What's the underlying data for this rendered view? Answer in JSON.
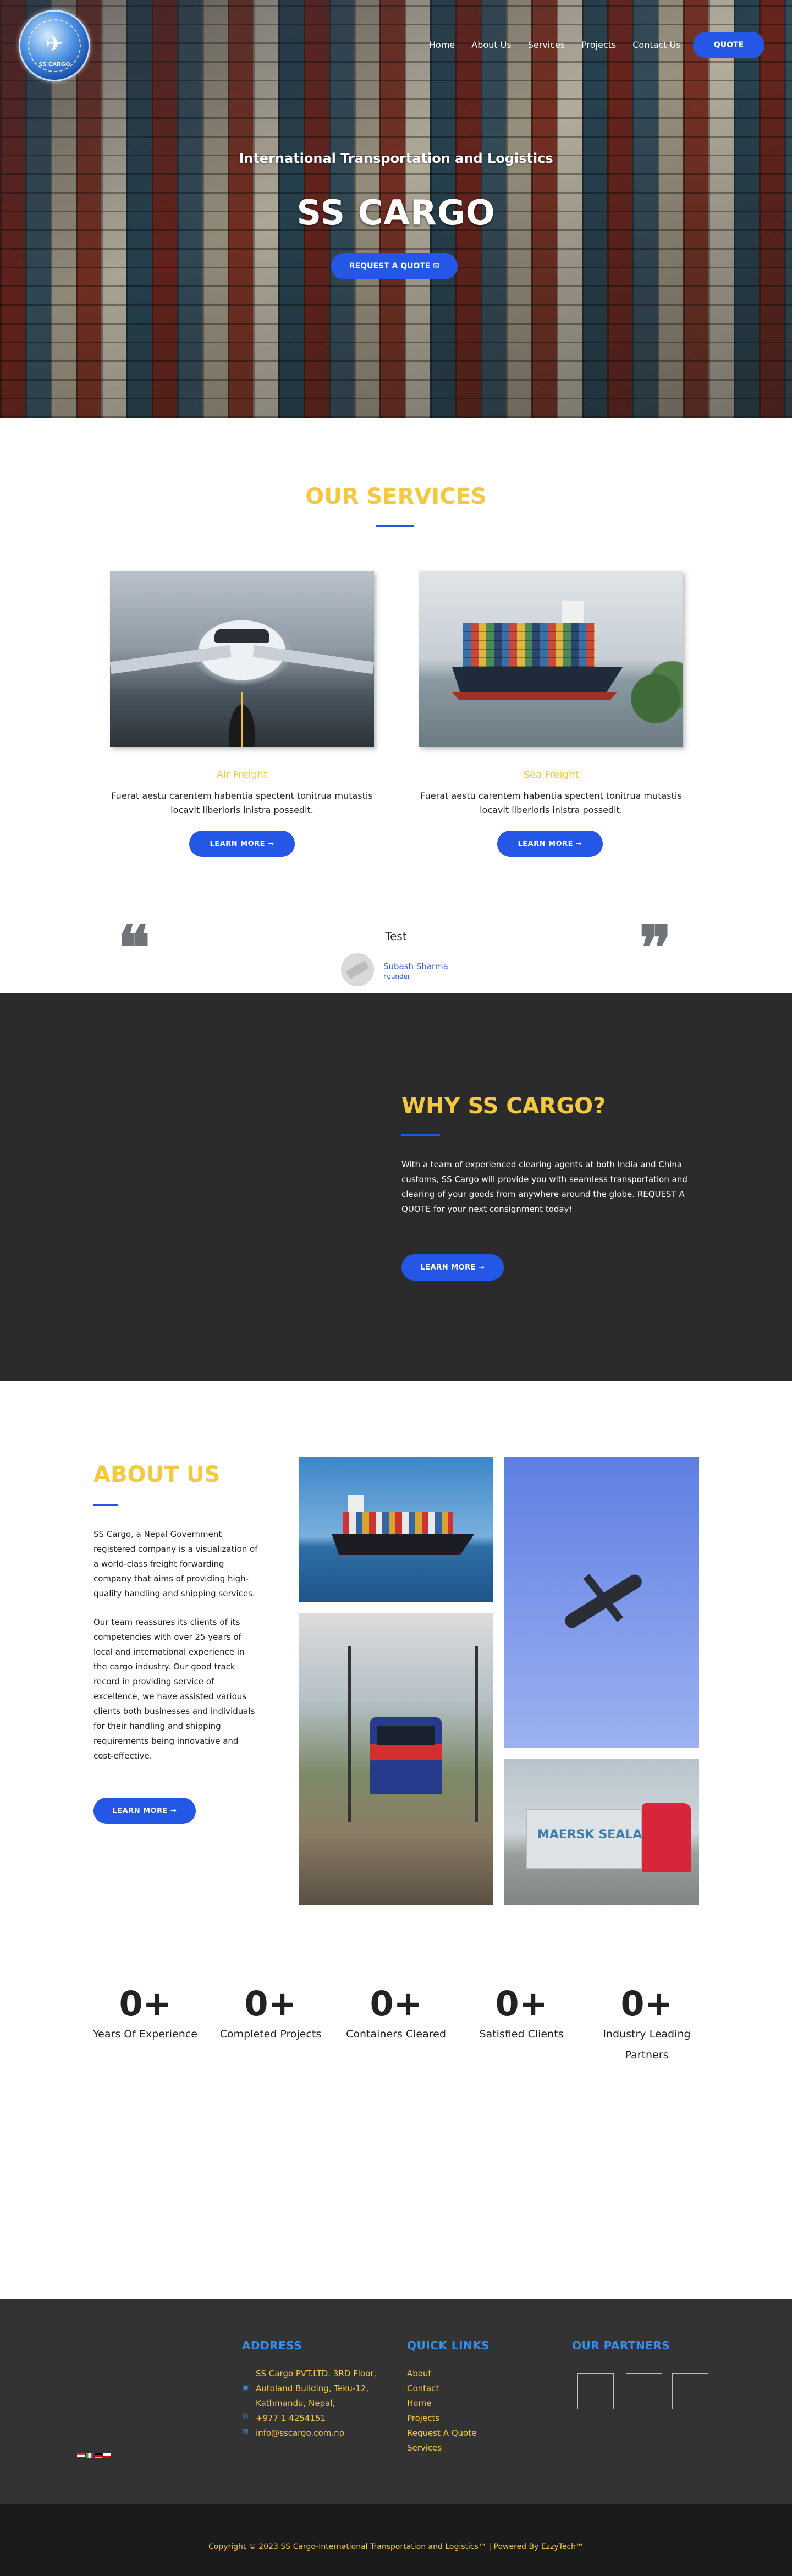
{
  "header": {
    "logo_text": "SS CARGO",
    "nav": [
      "Home",
      "About Us",
      "Services",
      "Projects",
      "Contact Us"
    ],
    "quote_button": "QUOTE"
  },
  "hero": {
    "subtitle": "International Transportation and Logistics",
    "title": "SS CARGO",
    "button": "REQUEST A QUOTE ✉"
  },
  "services": {
    "title": "OUR SERVICES",
    "items": [
      {
        "name": "Air Freight",
        "desc": "Fuerat aestu carentem habentia spectent tonitrua mutastis locavit liberioris inistra possedit.",
        "button": "LEARN MORE →"
      },
      {
        "name": "Sea Freight",
        "desc": "Fuerat aestu carentem habentia spectent tonitrua mutastis locavit liberioris inistra possedit.",
        "button": "LEARN MORE →"
      }
    ]
  },
  "testimonial": {
    "text": "Test",
    "name": "Subash Sharma",
    "role": "Founder"
  },
  "why": {
    "title": "WHY SS CARGO?",
    "text": "With a team of experienced clearing agents at both India and China customs, SS Cargo will provide you with seamless transportation and clearing of your goods from anywhere around the globe. REQUEST A QUOTE for your next consignment today!",
    "button": "LEARN MORE →"
  },
  "about": {
    "title": "ABOUT US",
    "p1": "SS Cargo, a Nepal Government registered company is a visualization of a world-class freight forwarding company that aims of providing high-quality handling and shipping services.",
    "p2": "Our team reassures its clients of its competencies with over 25 years of local and international experience in the cargo industry. Our good track record in providing service of excellence, we have assisted various clients both businesses and individuals for their handling and shipping requirements being innovative and cost-effective.",
    "button": "LEARN MORE →",
    "truck_label": "MAERSK SEALAND"
  },
  "counters": [
    {
      "value": "0+",
      "label": "Years Of Experience"
    },
    {
      "value": "0+",
      "label": "Completed Projects"
    },
    {
      "value": "0+",
      "label": "Containers Cleared"
    },
    {
      "value": "0+",
      "label": "Satisfied Clients"
    },
    {
      "value": "0+",
      "label": "Industry Leading Partners"
    }
  ],
  "footer": {
    "address_title": "ADDRESS",
    "address_lines": [
      "SS Cargo PVT.LTD. 3RD Floor,",
      "Autoland Building, Teku-12,",
      "Kathmandu, Nepal,"
    ],
    "phone": "+977 1 4254151",
    "email": "info@sscargo.com.np",
    "links_title": "QUICK LINKS",
    "links": [
      "About",
      "Contact",
      "Home",
      "Projects",
      "Request A Quote",
      "Services"
    ],
    "partners_title": "OUR PARTNERS"
  },
  "copyright": "Copyright © 2023 SS Cargo-International Transportation and Logistics™ | Powered By EzzyTech™",
  "colors": {
    "accent_blue": "#2557e6",
    "gold": "#f5c842",
    "dark": "#2b2b2b",
    "footer_bg": "#333333"
  }
}
